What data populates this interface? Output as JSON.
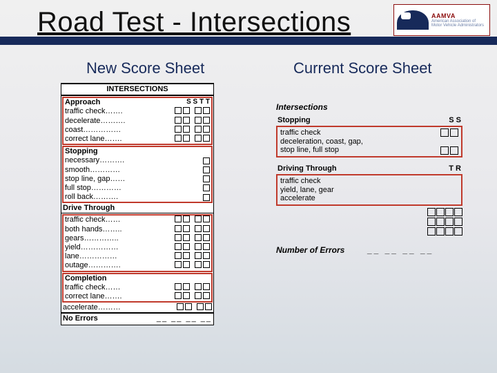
{
  "title": "Road Test - Intersections",
  "logo": {
    "abbr": "AAMVA",
    "sub1": "American Association of",
    "sub2": "Motor Vehicle Administrators"
  },
  "cols": {
    "left": "New Score Sheet",
    "right": "Current Score Sheet"
  },
  "left": {
    "header": "INTERSECTIONS",
    "approach": {
      "title": "Approach",
      "cols": "S  S     T  T",
      "rows": [
        "traffic check…….",
        "decelerate……….",
        "coast……………",
        "correct lane……."
      ]
    },
    "stopping": {
      "title": "Stopping",
      "rows": [
        "necessary……….",
        "smooth…………",
        "stop line, gap……",
        "full stop…………",
        "roll back………."
      ]
    },
    "drive": {
      "title": "Drive Through",
      "rows": [
        "traffic check……",
        "both hands……..",
        "gears…………..",
        "yield……………",
        "lane……………",
        "outage…………."
      ]
    },
    "completion": {
      "title": "Completion",
      "rows": [
        "traffic check……",
        "correct lane……."
      ],
      "extra": "accelerate………"
    },
    "noerrors": {
      "label": "No Errors",
      "dashes": "__  __   __  __"
    }
  },
  "right": {
    "header": "Intersections",
    "stopping": {
      "title": "Stopping",
      "lines": "traffic check\ndeceleration, coast, gap,\nstop line, full stop",
      "cols": "S S"
    },
    "driving": {
      "title": "Driving Through",
      "lines": "traffic check\nyield, lane, gear\naccelerate",
      "cols": "T   R"
    },
    "numerr": {
      "label": "Number of Errors",
      "dashes": "__ __ __ __"
    }
  }
}
